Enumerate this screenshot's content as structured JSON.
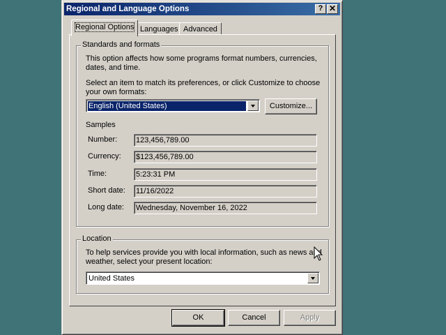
{
  "window": {
    "title": "Regional and Language Options",
    "help_label": "?",
    "close_label": "✕"
  },
  "tabs": [
    {
      "label": "Regional Options",
      "active": true
    },
    {
      "label": "Languages",
      "active": false
    },
    {
      "label": "Advanced",
      "active": false
    }
  ],
  "standards": {
    "group_title": "Standards and formats",
    "description": "This option affects how some programs format numbers, currencies, dates, and time.",
    "instruction": "Select an item to match its preferences, or click Customize to choose your own formats:",
    "selected_locale": "English (United States)",
    "customize_label": "Customize...",
    "samples_label": "Samples",
    "samples": [
      {
        "label": "Number:",
        "value": "123,456,789.00"
      },
      {
        "label": "Currency:",
        "value": "$123,456,789.00"
      },
      {
        "label": "Time:",
        "value": "5:23:31 PM"
      },
      {
        "label": "Short date:",
        "value": "11/16/2022"
      },
      {
        "label": "Long date:",
        "value": "Wednesday, November 16, 2022"
      }
    ]
  },
  "location": {
    "group_title": "Location",
    "description": "To help services provide you with local information, such as news and weather, select your present location:",
    "selected_location": "United States"
  },
  "footer": {
    "ok_label": "OK",
    "cancel_label": "Cancel",
    "apply_label": "Apply"
  },
  "colors": {
    "titlebar_start": "#0a246a",
    "face": "#d4d0c8",
    "selection": "#0a246a"
  }
}
